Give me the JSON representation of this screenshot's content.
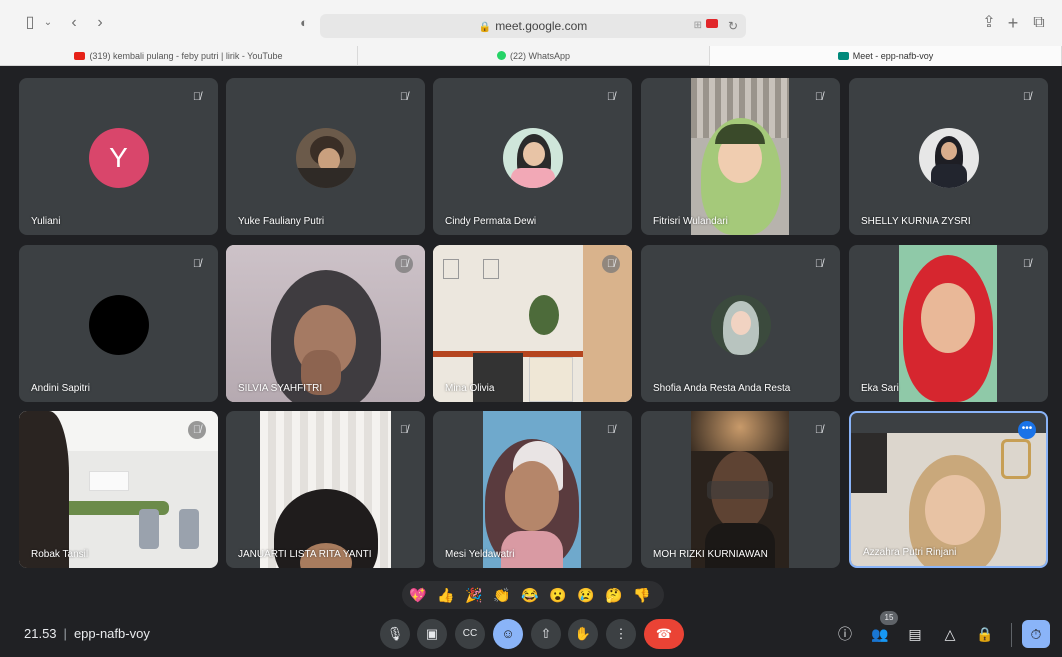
{
  "browser": {
    "url": "meet.google.com",
    "tabs": [
      {
        "label": "(319) kembali pulang - feby putri | lirik - YouTube",
        "icon": "youtube-icon",
        "color": "#e62117"
      },
      {
        "label": "(22) WhatsApp",
        "icon": "whatsapp-icon",
        "color": "#25d366"
      },
      {
        "label": "Meet - epp-nafb-voy",
        "icon": "meet-icon",
        "color": "#00897b"
      }
    ]
  },
  "participants": [
    {
      "name": "Yuliani",
      "avatar_letter": "Y",
      "avatar_color": "#d9466b"
    },
    {
      "name": "Yuke Fauliany Putri"
    },
    {
      "name": "Cindy Permata Dewi"
    },
    {
      "name": "Fitrisri Wulandari"
    },
    {
      "name": "SHELLY KURNIA ZYSRI"
    },
    {
      "name": "Andini Sapitri"
    },
    {
      "name": "SILVIA SYAHFITRI"
    },
    {
      "name": "Mina Olivia"
    },
    {
      "name": "Shofia Anda Resta Anda Resta"
    },
    {
      "name": "Eka Sari"
    },
    {
      "name": "Robak Tansil"
    },
    {
      "name": "JANUARTI LISTA RITA YANTI"
    },
    {
      "name": "Mesi Yeldawatri"
    },
    {
      "name": "MOH RIZKI KURNIAWAN"
    },
    {
      "name": "Azzahra Putri Rinjani"
    }
  ],
  "meeting": {
    "time": "21.53",
    "code": "epp-nafb-voy",
    "participant_count": "15"
  },
  "reactions": [
    "💖",
    "👍",
    "🎉",
    "👏",
    "😂",
    "😮",
    "😢",
    "🤔",
    "👎"
  ],
  "colors": {
    "background": "#202124",
    "tile": "#3c4043",
    "accent": "#8ab4f8",
    "end_call": "#ea4335"
  }
}
